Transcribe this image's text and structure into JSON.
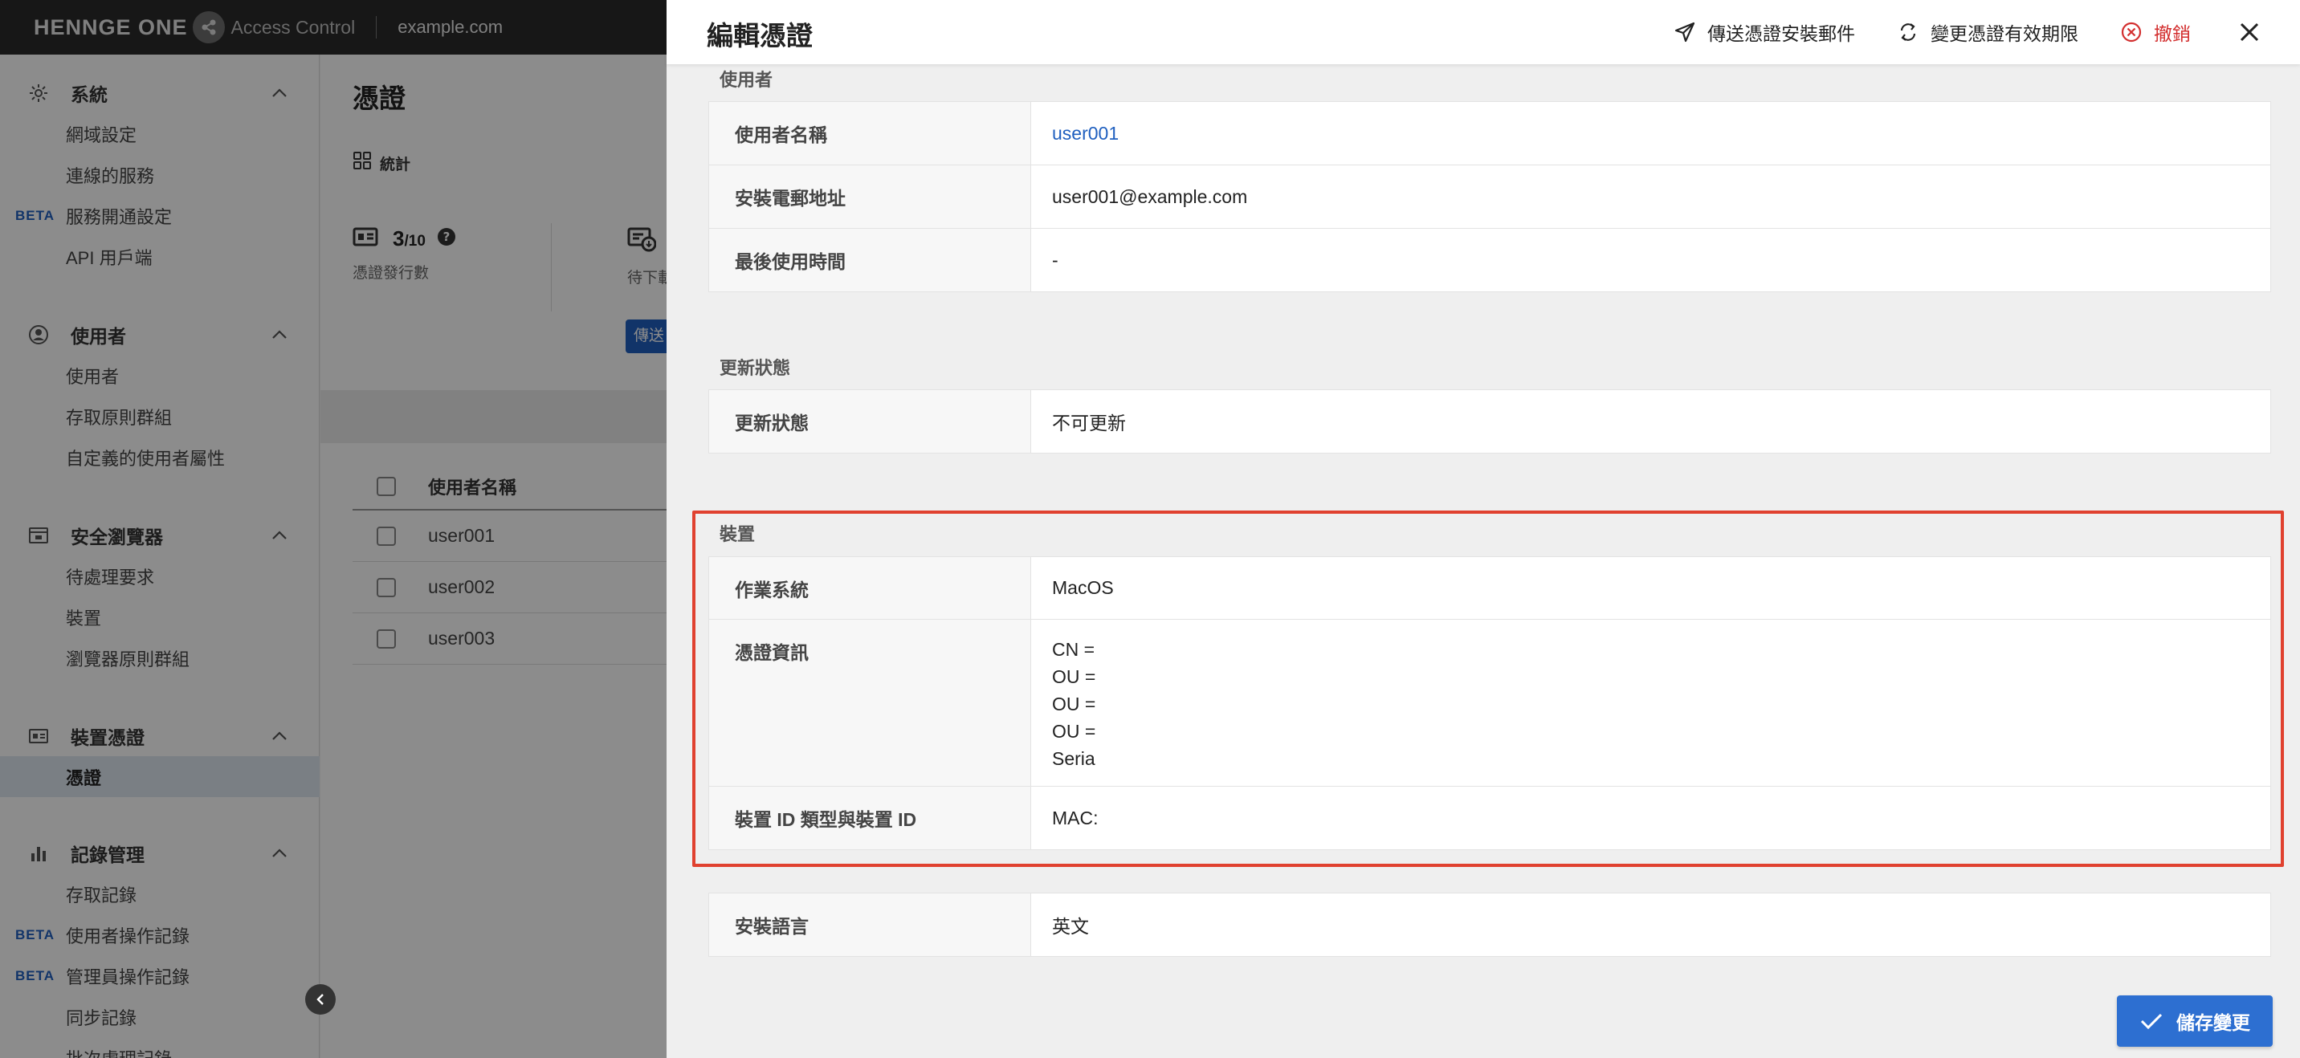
{
  "topbar": {
    "logo_text": "HENNGE ONE",
    "product": "Access Control",
    "domain": "example.com"
  },
  "sidebar": {
    "sections": [
      {
        "label": "系統",
        "icon": "gear-icon",
        "items": [
          {
            "label": "網域設定",
            "beta": ""
          },
          {
            "label": "連線的服務",
            "beta": ""
          },
          {
            "label": "服務開通設定",
            "beta": "BETA"
          },
          {
            "label": "API 用戶端",
            "beta": ""
          }
        ]
      },
      {
        "label": "使用者",
        "icon": "user-circle-icon",
        "items": [
          {
            "label": "使用者",
            "beta": ""
          },
          {
            "label": "存取原則群組",
            "beta": ""
          },
          {
            "label": "自定義的使用者屬性",
            "beta": ""
          }
        ]
      },
      {
        "label": "安全瀏覽器",
        "icon": "browser-icon",
        "items": [
          {
            "label": "待處理要求",
            "beta": ""
          },
          {
            "label": "裝置",
            "beta": ""
          },
          {
            "label": "瀏覽器原則群組",
            "beta": ""
          }
        ]
      },
      {
        "label": "裝置憑證",
        "icon": "id-card-icon",
        "items": [
          {
            "label": "憑證",
            "beta": "",
            "active": true
          }
        ]
      },
      {
        "label": "記錄管理",
        "icon": "bar-chart-icon",
        "items": [
          {
            "label": "存取記錄",
            "beta": ""
          },
          {
            "label": "使用者操作記錄",
            "beta": "BETA"
          },
          {
            "label": "管理員操作記錄",
            "beta": "BETA"
          },
          {
            "label": "同步記錄",
            "beta": ""
          },
          {
            "label": "批次處理記錄",
            "beta": ""
          }
        ]
      }
    ]
  },
  "main": {
    "title": "憑證",
    "stats_tab": "統計",
    "stat1": {
      "value": "3",
      "total": "/10",
      "caption": "憑證發行數"
    },
    "stat2": {
      "caption": "待下載"
    },
    "send_button": "傳送",
    "table": {
      "header": "使用者名稱",
      "rows": [
        "user001",
        "user002",
        "user003"
      ]
    }
  },
  "drawer": {
    "title": "編輯憑證",
    "actions": {
      "send_mail": "傳送憑證安裝郵件",
      "change_expiry": "變更憑證有效期限",
      "revoke": "撤銷"
    },
    "sections": {
      "user": {
        "title": "使用者",
        "rows": [
          {
            "label": "使用者名稱",
            "value": "user001"
          },
          {
            "label": "安裝電郵地址",
            "value": "user001@example.com"
          },
          {
            "label": "最後使用時間",
            "value": "-"
          }
        ]
      },
      "update": {
        "title": "更新狀態",
        "rows": [
          {
            "label": "更新狀態",
            "value": "不可更新"
          }
        ]
      },
      "device": {
        "title": "裝置",
        "os": {
          "label": "作業系統",
          "value": "MacOS"
        },
        "cert": {
          "label": "憑證資訊",
          "lines": [
            "CN =",
            "OU =",
            "OU =",
            "OU =",
            "Seria"
          ]
        },
        "device_id": {
          "label": "裝置 ID 類型與裝置 ID",
          "value": "MAC:"
        }
      },
      "language": {
        "rows": [
          {
            "label": "安裝語言",
            "value": "英文"
          }
        ]
      }
    },
    "save_button": "儲存變更"
  },
  "colors": {
    "accent": "#1f5fbf",
    "highlight": "#e0412f",
    "revoke": "#d32f2f"
  }
}
